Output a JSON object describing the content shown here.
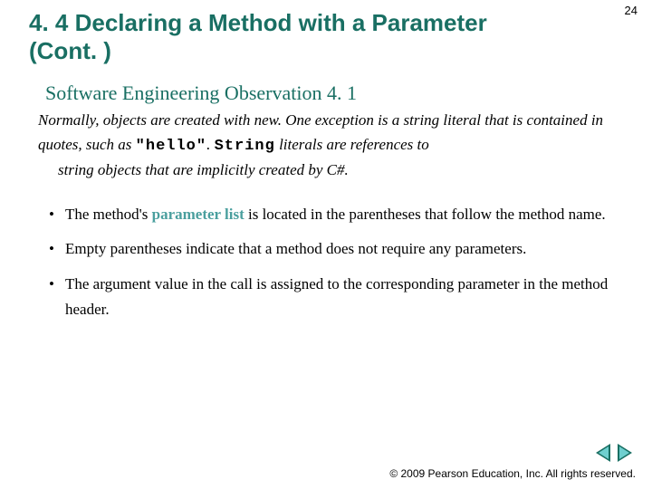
{
  "page_number": "24",
  "title_line1": "4. 4  Declaring a Method with a Parameter",
  "title_line2": "(Cont. )",
  "observation": {
    "heading": "Software Engineering Observation 4. 1",
    "part1": "Normally, objects are created with new. One exception is a string literal that is contained in quotes, such as ",
    "code1": "\"hello\"",
    "part2": ". ",
    "code2": "String",
    "part3": " literals are references to ",
    "indent_tail": "string objects that are implicitly created by C#."
  },
  "bullets": [
    {
      "pre": "The method's ",
      "term": "parameter list",
      "post": " is located in the parentheses that follow the method name."
    },
    {
      "pre": "Empty parentheses indicate that a method does not require any parameters.",
      "term": "",
      "post": ""
    },
    {
      "pre": "The argument value in the call is assigned to the corresponding parameter in the method header.",
      "term": "",
      "post": ""
    }
  ],
  "footer": "© 2009 Pearson Education, Inc.  All rights reserved.",
  "nav": {
    "prev": "previous-slide",
    "next": "next-slide"
  }
}
